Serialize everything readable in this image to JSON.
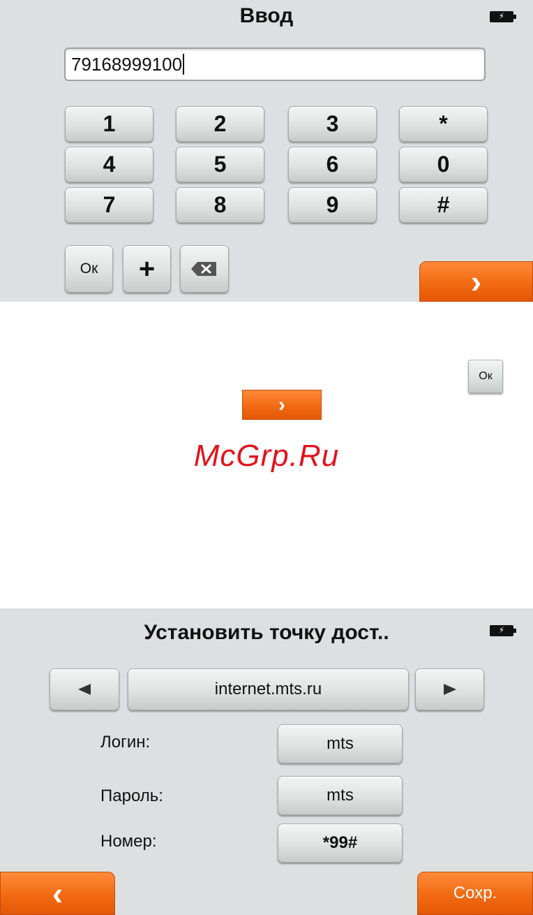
{
  "screen1": {
    "title": "Ввод",
    "input_value": "79168999100",
    "keys": [
      "1",
      "2",
      "3",
      "*",
      "4",
      "5",
      "6",
      "0",
      "7",
      "8",
      "9",
      "#"
    ],
    "ok_label": "Ок",
    "plus_label": "+",
    "next_symbol": "›"
  },
  "legend": {
    "ok_label": "Ок",
    "next_symbol": "›"
  },
  "watermark": "McGrp.Ru",
  "screen2": {
    "title": "Установить точку дост..",
    "apn_value": "internet.mts.ru",
    "login_label": "Логин:",
    "login_value": "mts",
    "password_label": "Пароль:",
    "password_value": "mts",
    "number_label": "Номер:",
    "number_value": "*99#",
    "back_symbol": "‹",
    "save_label": "Сохр."
  },
  "colors": {
    "accent_orange": "#f26a12",
    "panel_gray": "#dde0e0",
    "watermark_red": "#e2131b"
  }
}
